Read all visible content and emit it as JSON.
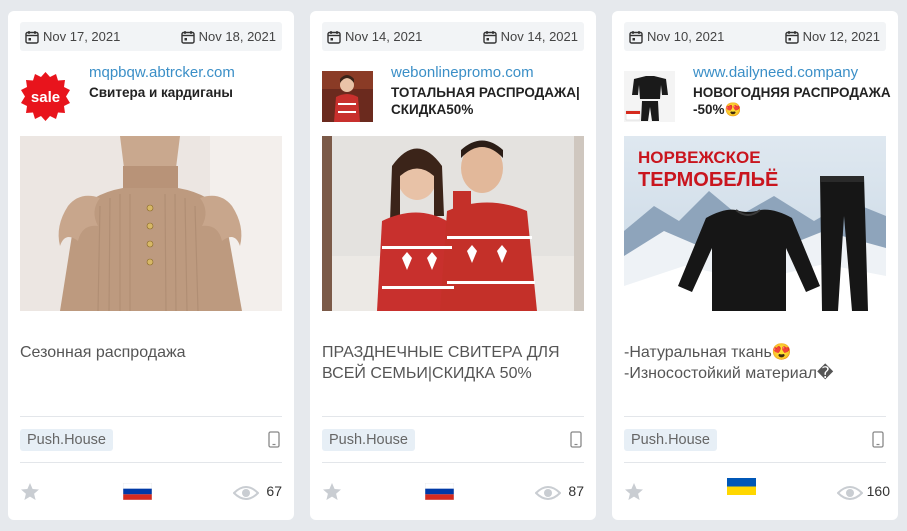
{
  "cards": [
    {
      "date_start": "Nov 17, 2021",
      "date_end": "Nov 18, 2021",
      "url": "mqpbqw.abtrcker.com",
      "title": "Свитера и кардиганы",
      "icon_badge": "sale",
      "description": "Сезонная распродажа",
      "source": "Push.House",
      "flag": "russia",
      "views": "67"
    },
    {
      "date_start": "Nov 14, 2021",
      "date_end": "Nov 14, 2021",
      "url": "webonlinepromo.com",
      "title": "ТОТАЛЬНАЯ РАСПРОДАЖА| СКИДКА50%",
      "description": "ПРАЗДНЕЧНЫЕ СВИТЕРА ДЛЯ ВСЕЙ СЕМЬИ|СКИДКА 50%",
      "source": "Push.House",
      "flag": "russia",
      "views": "87"
    },
    {
      "date_start": "Nov 10, 2021",
      "date_end": "Nov 12, 2021",
      "url": "www.dailyneed.company",
      "title": "НОВОГОДНЯЯ РАСПРОДАЖА -50%😍",
      "banner_text_line1": "НОРВЕЖСКОЕ",
      "banner_text_line2": "ТЕРМОБЕЛЬЁ",
      "description": "-Натуральная ткань😍 -Износостойкий материал�",
      "source": "Push.House",
      "flag": "ukraine",
      "views": "160"
    }
  ],
  "colors": {
    "url": "#3b8fc7",
    "background": "#e6e9ed",
    "sale_badge": "#e8141c",
    "sweater_red": "#c8302d"
  },
  "icons": [
    "calendar-icon",
    "mobile-device-icon",
    "star-icon",
    "eye-icon"
  ]
}
